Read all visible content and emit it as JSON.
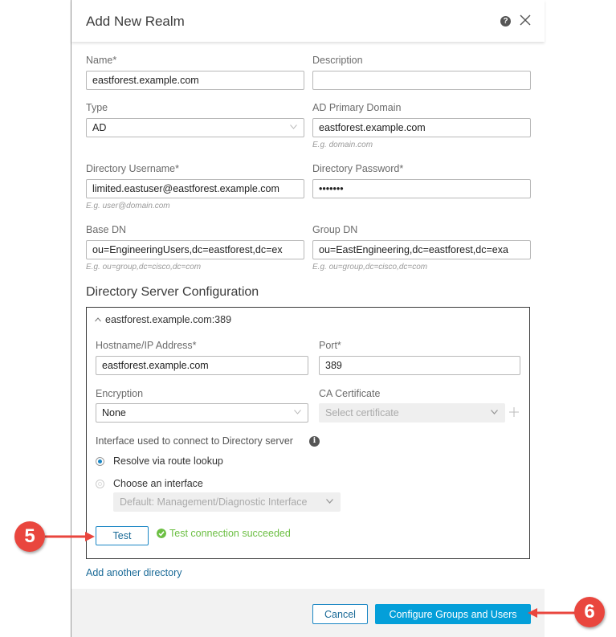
{
  "dialog": {
    "title": "Add New Realm",
    "help_icon": "question-circle-icon",
    "close_icon": "close-x-icon"
  },
  "form": {
    "name": {
      "label": "Name*",
      "value": "eastforest.example.com"
    },
    "description": {
      "label": "Description",
      "value": ""
    },
    "type": {
      "label": "Type",
      "value": "AD"
    },
    "ad_primary_domain": {
      "label": "AD Primary Domain",
      "value": "eastforest.example.com",
      "hint": "E.g. domain.com"
    },
    "directory_username": {
      "label": "Directory Username*",
      "value": "limited.eastuser@eastforest.example.com",
      "hint": "E.g. user@domain.com"
    },
    "directory_password": {
      "label": "Directory Password*",
      "value": "•••••••"
    },
    "base_dn": {
      "label": "Base DN",
      "value": "ou=EngineeringUsers,dc=eastforest,dc=ex",
      "hint": "E.g. ou=group,dc=cisco,dc=com"
    },
    "group_dn": {
      "label": "Group DN",
      "value": "ou=EastEngineering,dc=eastforest,dc=exa",
      "hint": "E.g. ou=group,dc=cisco,dc=com"
    }
  },
  "directory_server": {
    "section_title": "Directory Server Configuration",
    "server_header": "eastforest.example.com:389",
    "hostname": {
      "label": "Hostname/IP Address*",
      "value": "eastforest.example.com"
    },
    "port": {
      "label": "Port*",
      "value": "389"
    },
    "encryption": {
      "label": "Encryption",
      "value": "None"
    },
    "ca_certificate": {
      "label": "CA Certificate",
      "placeholder": "Select certificate"
    },
    "interface_label": "Interface used to connect to Directory server",
    "radio_resolve": "Resolve via route lookup",
    "radio_choose": "Choose an interface",
    "interface_select": "Default: Management/Diagnostic Interface",
    "test_button": "Test",
    "test_status": "Test connection succeeded"
  },
  "add_another_directory": "Add another directory",
  "footer": {
    "cancel": "Cancel",
    "configure": "Configure Groups and Users"
  },
  "callouts": {
    "step5": "5",
    "step6": "6"
  },
  "colors": {
    "primary": "#049fd9",
    "success": "#6cbf43",
    "callout": "#e9463e"
  }
}
